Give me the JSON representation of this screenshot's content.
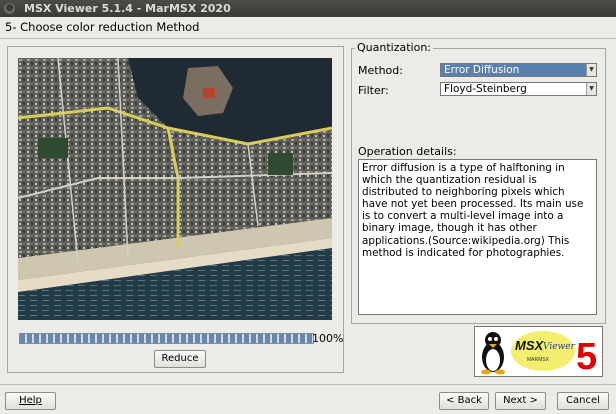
{
  "window": {
    "title": "MSX Viewer 5.1.4 - MarMSX 2020",
    "close_glyph": "●"
  },
  "step": {
    "title": "5- Choose color reduction Method"
  },
  "preview": {
    "progress_percent": 100,
    "progress_label": "100%",
    "reduce_label": "Reduce"
  },
  "quantization": {
    "legend": "Quantization:",
    "method_label": "Method:",
    "method_value": "Error Diffusion",
    "filter_label": "Filter:",
    "filter_value": "Floyd-Steinberg",
    "details_label": "Operation details:",
    "details_text": "Error diffusion is a type of halftoning in which the quantization residual is distributed to neighboring pixels which have not yet been processed. Its main use is to convert a multi-level image into a binary image, though it has other applications.(Source:wikipedia.org) This method is indicated for photographies."
  },
  "logo": {
    "brand": "MSX",
    "script": "Viewer",
    "version": "5",
    "sub": "MARMSX"
  },
  "footer": {
    "help": "Help",
    "back": "< Back",
    "next": "Next >",
    "cancel": "Cancel"
  }
}
